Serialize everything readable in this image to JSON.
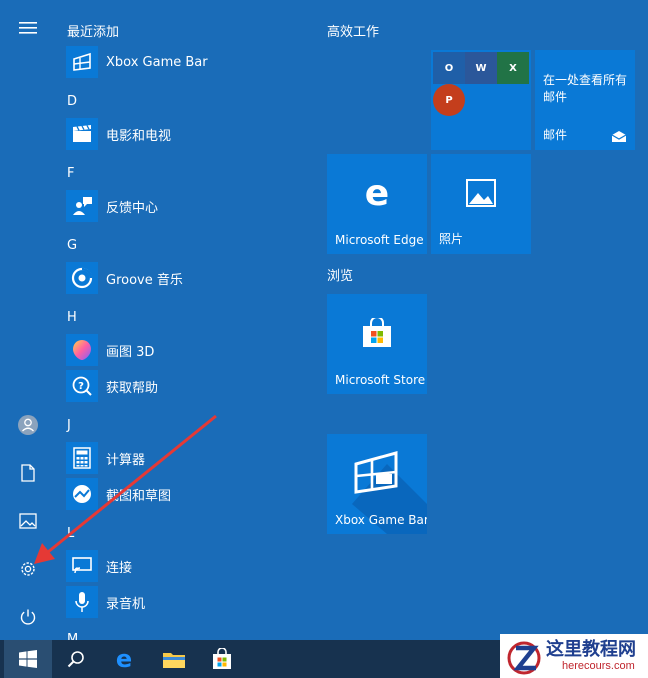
{
  "app_list": {
    "recent_header": "最近添加",
    "xbox": "Xbox Game Bar",
    "letter_d": "D",
    "movies": "电影和电视",
    "letter_f": "F",
    "feedback": "反馈中心",
    "letter_g": "G",
    "groove": "Groove 音乐",
    "letter_h": "H",
    "paint3d": "画图 3D",
    "gethelp": "获取帮助",
    "letter_j": "J",
    "calculator": "计算器",
    "snip": "截图和草图",
    "letter_l": "L",
    "connect": "连接",
    "recorder": "录音机",
    "letter_m": "M"
  },
  "tiles": {
    "group_productivity": "高效工作",
    "group_browse": "浏览",
    "mail_text": "在一处查看所有邮件",
    "mail_label": "邮件",
    "office_outlook": "O",
    "office_word": "W",
    "office_excel": "X",
    "office_ppt": "P",
    "edge": "Microsoft Edge",
    "photos": "照片",
    "store": "Microsoft Store",
    "xbox": "Xbox Game Bar"
  },
  "watermark": {
    "title": "这里教程网",
    "url": "herecours.com"
  },
  "colors": {
    "background": "#1a6cb8",
    "tile": "#0a79d6",
    "taskbar": "#17324f",
    "arrow": "#e53935"
  },
  "icons": {
    "rail": [
      "hamburger-icon",
      "user-icon",
      "document-icon",
      "pictures-icon",
      "settings-icon",
      "power-icon"
    ],
    "taskbar": [
      "windows-start-icon",
      "search-icon",
      "edge-icon",
      "file-explorer-icon",
      "store-icon"
    ]
  }
}
